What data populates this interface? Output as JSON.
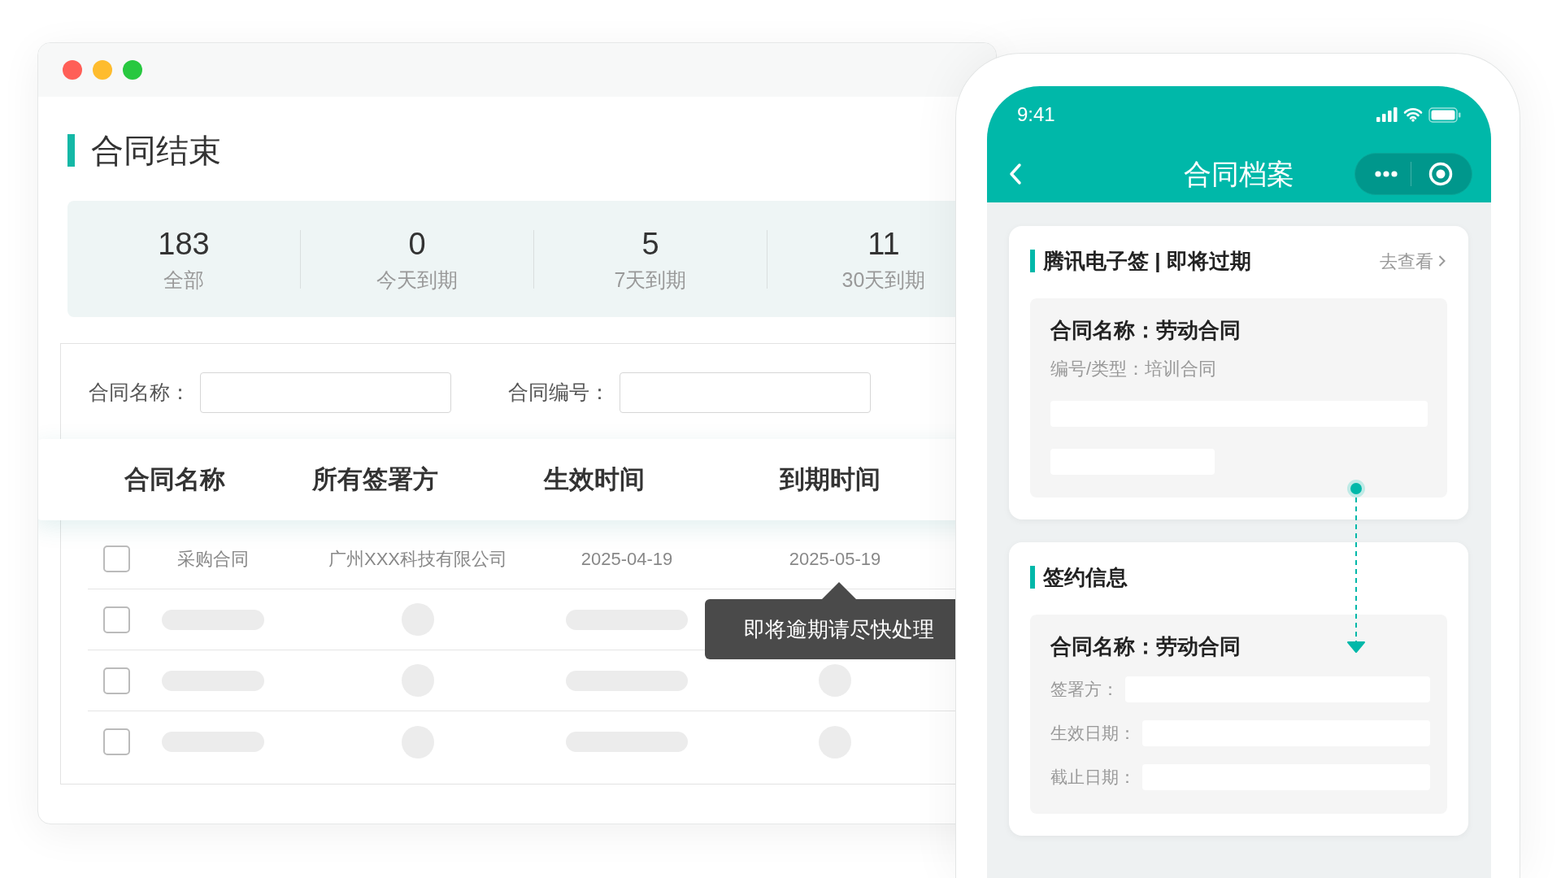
{
  "desktop": {
    "title": "合同结束",
    "stats": [
      {
        "value": "183",
        "label": "全部"
      },
      {
        "value": "0",
        "label": "今天到期"
      },
      {
        "value": "5",
        "label": "7天到期"
      },
      {
        "value": "11",
        "label": "30天到期"
      }
    ],
    "filters": [
      {
        "label": "合同名称："
      },
      {
        "label": "合同编号："
      }
    ],
    "table": {
      "columns": [
        "合同名称",
        "所有签署方",
        "生效时间",
        "到期时间"
      ],
      "rows": [
        {
          "kind": "data",
          "checked": false,
          "cells": [
            "采购合同",
            "广州XXX科技有限公司",
            "2025-04-19",
            "2025-05-19"
          ]
        },
        {
          "kind": "skeleton",
          "checked": false
        },
        {
          "kind": "skeleton",
          "checked": false
        },
        {
          "kind": "skeleton",
          "checked": false
        }
      ]
    },
    "tooltip": "即将逾期请尽快处理"
  },
  "phone": {
    "status_bar": {
      "time": "9:41"
    },
    "nav": {
      "title": "合同档案"
    },
    "cards": [
      {
        "title": "腾讯电子签 | 即将过期",
        "link": "去查看",
        "heading": "合同名称：劳动合同",
        "subtitle": "编号/类型：培训合同"
      },
      {
        "title": "签约信息",
        "heading": "合同名称：劳动合同",
        "fields": [
          "签署方：",
          "生效日期：",
          "截止日期："
        ]
      }
    ]
  }
}
